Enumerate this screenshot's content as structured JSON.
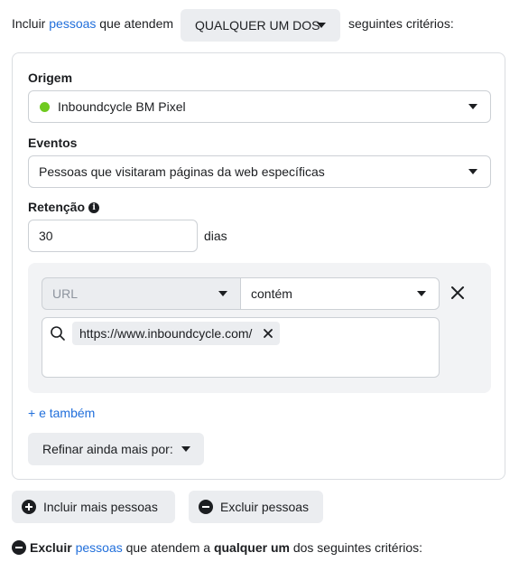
{
  "top": {
    "prefix": "Incluir",
    "people_link": "pessoas",
    "middle": "que atendem",
    "match_dropdown": "QUALQUER UM DOS",
    "suffix": "seguintes critérios:"
  },
  "origin": {
    "label": "Origem",
    "value": "Inboundcycle BM Pixel",
    "status_color": "#6fca1f"
  },
  "events": {
    "label": "Eventos",
    "value": "Pessoas que visitaram páginas da web específicas"
  },
  "retention": {
    "label": "Retenção",
    "info_icon": "info-icon",
    "value": "30",
    "unit": "dias"
  },
  "rule": {
    "field": "URL",
    "operator": "contém",
    "remove_icon": "close-icon",
    "search_icon": "search-icon",
    "tags": [
      "https://www.inboundcycle.com/"
    ]
  },
  "and_also": "+ e também",
  "refine": "Refinar ainda mais por:",
  "buttons": {
    "include_more": "Incluir mais pessoas",
    "exclude": "Excluir pessoas"
  },
  "bottom": {
    "prefix": "Excluir",
    "people_link": "pessoas",
    "middle": "que atendem a",
    "any": "qualquer um",
    "suffix": "dos seguintes critérios:"
  },
  "colors": {
    "link": "#216fdb",
    "text": "#1c1e21",
    "button_bg": "#ebedf0"
  }
}
